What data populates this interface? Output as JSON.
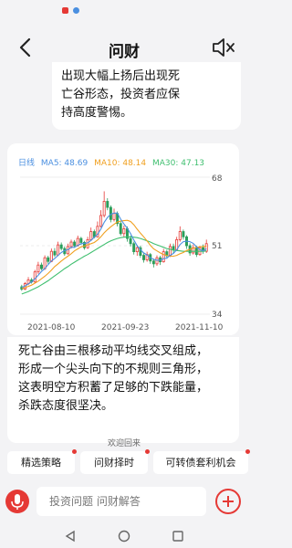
{
  "header": {
    "title": "问财"
  },
  "intro_bubble": {
    "lines": [
      "出现大幅上扬后出现死",
      "亡谷形态，投资者应保",
      "持高度警惕。"
    ]
  },
  "chart_card": {
    "period_label": "日线",
    "ma5_label": "MA5: 48.69",
    "ma10_label": "MA10: 48.14",
    "ma30_label": "MA30: 47.13",
    "colors": {
      "up": "#e53935",
      "down": "#2a9d5a",
      "ma5": "#4a8fe0",
      "ma10": "#f0a020",
      "ma30": "#3fbf6f"
    }
  },
  "chart_data": {
    "type": "candlestick",
    "y_ticks": [
      "68",
      "51",
      "34"
    ],
    "ylim": [
      34,
      68
    ],
    "x_tick_labels": [
      "2021-08-10",
      "2021-09-23",
      "2021-11-10"
    ],
    "candles": [
      [
        40.8,
        40.2,
        41.3,
        39.8
      ],
      [
        40.2,
        41.6,
        42.0,
        40.0
      ],
      [
        41.6,
        42.5,
        43.2,
        41.2
      ],
      [
        42.5,
        42.0,
        43.0,
        41.6
      ],
      [
        42.0,
        44.5,
        45.0,
        41.8
      ],
      [
        44.5,
        46.2,
        47.0,
        44.0
      ],
      [
        46.2,
        45.3,
        46.8,
        44.9
      ],
      [
        45.3,
        48.0,
        48.6,
        45.0
      ],
      [
        48.0,
        47.1,
        48.5,
        46.5
      ],
      [
        47.1,
        49.6,
        50.3,
        46.9
      ],
      [
        49.6,
        48.7,
        50.4,
        48.2
      ],
      [
        48.7,
        51.2,
        52.0,
        48.4
      ],
      [
        51.2,
        50.3,
        51.8,
        49.8
      ],
      [
        50.3,
        49.0,
        50.8,
        48.5
      ],
      [
        49.0,
        50.8,
        51.5,
        48.8
      ],
      [
        50.8,
        51.9,
        52.5,
        50.3
      ],
      [
        51.9,
        51.0,
        52.4,
        50.5
      ],
      [
        51.0,
        52.8,
        53.5,
        50.8
      ],
      [
        52.8,
        51.8,
        53.2,
        51.2
      ],
      [
        51.8,
        50.5,
        52.2,
        50.0
      ],
      [
        50.5,
        52.5,
        53.2,
        50.2
      ],
      [
        52.5,
        54.5,
        55.5,
        52.2
      ],
      [
        54.5,
        53.2,
        55.0,
        52.8
      ],
      [
        53.2,
        55.8,
        57.0,
        53.0
      ],
      [
        55.8,
        58.5,
        59.8,
        55.5
      ],
      [
        58.5,
        62.0,
        64.5,
        58.0
      ],
      [
        62.0,
        60.5,
        62.8,
        59.8
      ],
      [
        60.5,
        57.5,
        61.0,
        56.8
      ],
      [
        57.5,
        59.0,
        60.2,
        57.0
      ],
      [
        59.0,
        56.5,
        59.5,
        55.8
      ],
      [
        56.5,
        54.0,
        57.0,
        53.5
      ],
      [
        54.0,
        55.2,
        56.0,
        53.2
      ],
      [
        55.2,
        52.8,
        55.8,
        52.0
      ],
      [
        52.8,
        51.5,
        53.5,
        50.8
      ],
      [
        51.5,
        49.5,
        52.0,
        48.8
      ],
      [
        49.5,
        50.5,
        51.2,
        48.5
      ],
      [
        50.5,
        48.6,
        51.0,
        48.0
      ],
      [
        48.6,
        47.5,
        49.2,
        46.8
      ],
      [
        47.5,
        48.8,
        49.5,
        47.0
      ],
      [
        48.8,
        47.2,
        49.2,
        46.5
      ],
      [
        47.2,
        46.5,
        47.8,
        45.6
      ],
      [
        46.5,
        48.0,
        48.6,
        46.0
      ],
      [
        48.0,
        47.0,
        48.5,
        46.2
      ],
      [
        47.0,
        49.5,
        50.2,
        46.8
      ],
      [
        49.5,
        48.5,
        50.0,
        47.8
      ],
      [
        48.5,
        50.8,
        51.5,
        48.2
      ],
      [
        50.8,
        50.0,
        51.5,
        49.2
      ],
      [
        50.0,
        52.5,
        53.2,
        49.8
      ],
      [
        52.5,
        54.5,
        55.8,
        52.0
      ],
      [
        54.5,
        53.2,
        55.0,
        52.5
      ],
      [
        53.2,
        51.0,
        53.6,
        50.2
      ],
      [
        51.0,
        49.2,
        51.6,
        48.5
      ],
      [
        49.2,
        50.5,
        51.3,
        48.8
      ],
      [
        50.5,
        48.8,
        51.0,
        48.2
      ],
      [
        48.8,
        50.5,
        51.0,
        48.5
      ],
      [
        50.5,
        49.6,
        51.3,
        49.0
      ],
      [
        49.6,
        51.5,
        52.5,
        49.2
      ]
    ],
    "ma5": [
      40.6,
      41.0,
      41.5,
      42.0,
      42.8,
      43.7,
      44.6,
      45.3,
      46.3,
      47.2,
      47.8,
      48.6,
      49.3,
      49.8,
      50.0,
      50.6,
      50.6,
      51.1,
      51.5,
      51.6,
      51.7,
      52.3,
      53.1,
      53.8,
      55.1,
      56.8,
      58.0,
      58.8,
      59.1,
      59.1,
      57.6,
      56.4,
      55.3,
      54.0,
      52.4,
      51.0,
      50.0,
      49.2,
      48.7,
      48.0,
      47.6,
      47.4,
      47.4,
      47.8,
      47.9,
      48.6,
      49.1,
      50.0,
      51.3,
      52.0,
      52.1,
      52.0,
      51.6,
      50.7,
      50.0,
      49.7,
      50.2
    ],
    "ma10": [
      40.4,
      40.6,
      40.9,
      41.2,
      41.7,
      42.2,
      42.8,
      43.4,
      44.1,
      44.9,
      45.8,
      46.5,
      47.2,
      47.8,
      48.4,
      49.0,
      49.7,
      50.2,
      50.7,
      50.9,
      51.2,
      51.5,
      51.8,
      52.4,
      53.2,
      54.2,
      55.0,
      55.7,
      56.3,
      56.9,
      57.1,
      57.2,
      57.3,
      57.0,
      56.2,
      55.1,
      54.1,
      53.2,
      52.2,
      51.1,
      50.2,
      49.7,
      49.2,
      48.8,
      48.6,
      48.4,
      48.4,
      48.6,
      49.0,
      49.3,
      49.8,
      50.1,
      50.4,
      50.6,
      50.7,
      50.8,
      50.9
    ],
    "ma30": [
      39.0,
      39.3,
      39.6,
      40.0,
      40.4,
      40.8,
      41.3,
      41.8,
      42.3,
      42.9,
      43.5,
      44.1,
      44.7,
      45.3,
      45.8,
      46.4,
      46.9,
      47.4,
      47.9,
      48.4,
      48.8,
      49.3,
      49.8,
      50.3,
      50.8,
      51.3,
      51.8,
      52.2,
      52.5,
      52.8,
      53.0,
      53.1,
      53.2,
      53.2,
      53.1,
      53.0,
      52.8,
      52.5,
      52.2,
      51.9,
      51.5,
      51.2,
      50.9,
      50.6,
      50.3,
      50.1,
      49.9,
      49.8,
      49.7,
      49.6,
      49.6,
      49.6,
      49.6,
      49.6,
      49.6,
      49.6,
      49.7
    ]
  },
  "description": {
    "lines": [
      "死亡谷由三根移动平均线交叉组成，",
      "形成一个尖头向下的不规则三角形，",
      "这表明空方积蓄了足够的下跌能量，",
      "杀跌态度很坚决。"
    ]
  },
  "welcome_text": "欢迎回来",
  "quick_chips": [
    {
      "label": "精选策略"
    },
    {
      "label": "问财择时"
    },
    {
      "label": "可转债套利机会"
    }
  ],
  "input": {
    "placeholder": "投资问题 问财解答"
  },
  "accent_color": "#e53935"
}
